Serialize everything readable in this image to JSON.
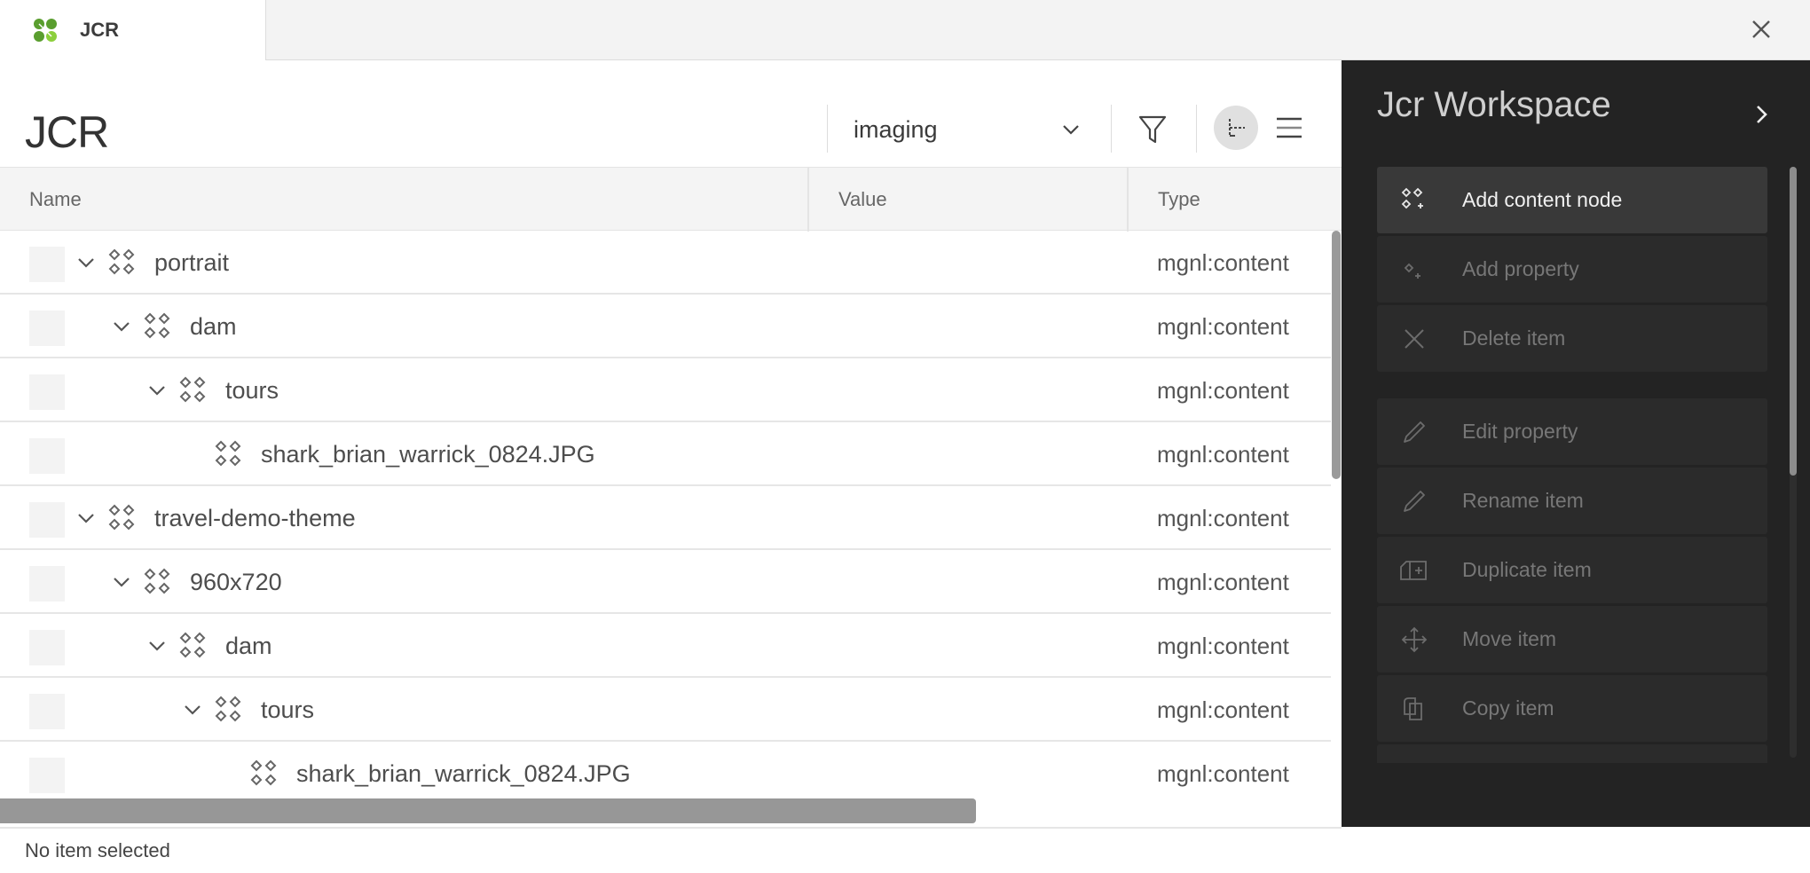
{
  "tab": {
    "label": "JCR",
    "icon": "magnolia-logo-icon",
    "brand_colors": [
      "#5a9e2f",
      "#8ccf3c"
    ]
  },
  "window": {
    "close_icon": "close-icon"
  },
  "header": {
    "title": "JCR",
    "workspace_select": {
      "value": "imaging",
      "icon": "chevron-down-icon"
    },
    "filter_icon": "filter-icon",
    "tree_view_icon": "tree-view-icon",
    "list_view_icon": "menu-icon"
  },
  "table": {
    "columns": [
      "Name",
      "Value",
      "Type"
    ],
    "rows": [
      {
        "name": "portrait",
        "level": 0,
        "expanded": true,
        "value": "",
        "type": "mgnl:content"
      },
      {
        "name": "dam",
        "level": 1,
        "expanded": true,
        "value": "",
        "type": "mgnl:content"
      },
      {
        "name": "tours",
        "level": 2,
        "expanded": true,
        "value": "",
        "type": "mgnl:content"
      },
      {
        "name": "shark_brian_warrick_0824.JPG",
        "level": 3,
        "expanded": null,
        "value": "",
        "type": "mgnl:content"
      },
      {
        "name": "travel-demo-theme",
        "level": 0,
        "expanded": true,
        "value": "",
        "type": "mgnl:content"
      },
      {
        "name": "960x720",
        "level": 1,
        "expanded": true,
        "value": "",
        "type": "mgnl:content"
      },
      {
        "name": "dam",
        "level": 2,
        "expanded": true,
        "value": "",
        "type": "mgnl:content"
      },
      {
        "name": "tours",
        "level": 3,
        "expanded": true,
        "value": "",
        "type": "mgnl:content"
      },
      {
        "name": "shark_brian_warrick_0824.JPG",
        "level": 4,
        "expanded": null,
        "value": "",
        "type": "mgnl:content"
      }
    ]
  },
  "status": {
    "text": "No item selected"
  },
  "panel": {
    "title": "Jcr Workspace",
    "toggle_icon": "chevron-right-icon",
    "actions": [
      {
        "label": "Add content node",
        "icon": "add-node-icon",
        "enabled": true
      },
      {
        "label": "Add property",
        "icon": "add-property-icon",
        "enabled": false
      },
      {
        "label": "Delete item",
        "icon": "delete-icon",
        "enabled": false
      },
      {
        "label": "Edit property",
        "icon": "pencil-icon",
        "enabled": false
      },
      {
        "label": "Rename item",
        "icon": "pencil-icon",
        "enabled": false
      },
      {
        "label": "Duplicate item",
        "icon": "duplicate-icon",
        "enabled": false
      },
      {
        "label": "Move item",
        "icon": "move-icon",
        "enabled": false
      },
      {
        "label": "Copy item",
        "icon": "copy-icon",
        "enabled": false
      }
    ]
  }
}
